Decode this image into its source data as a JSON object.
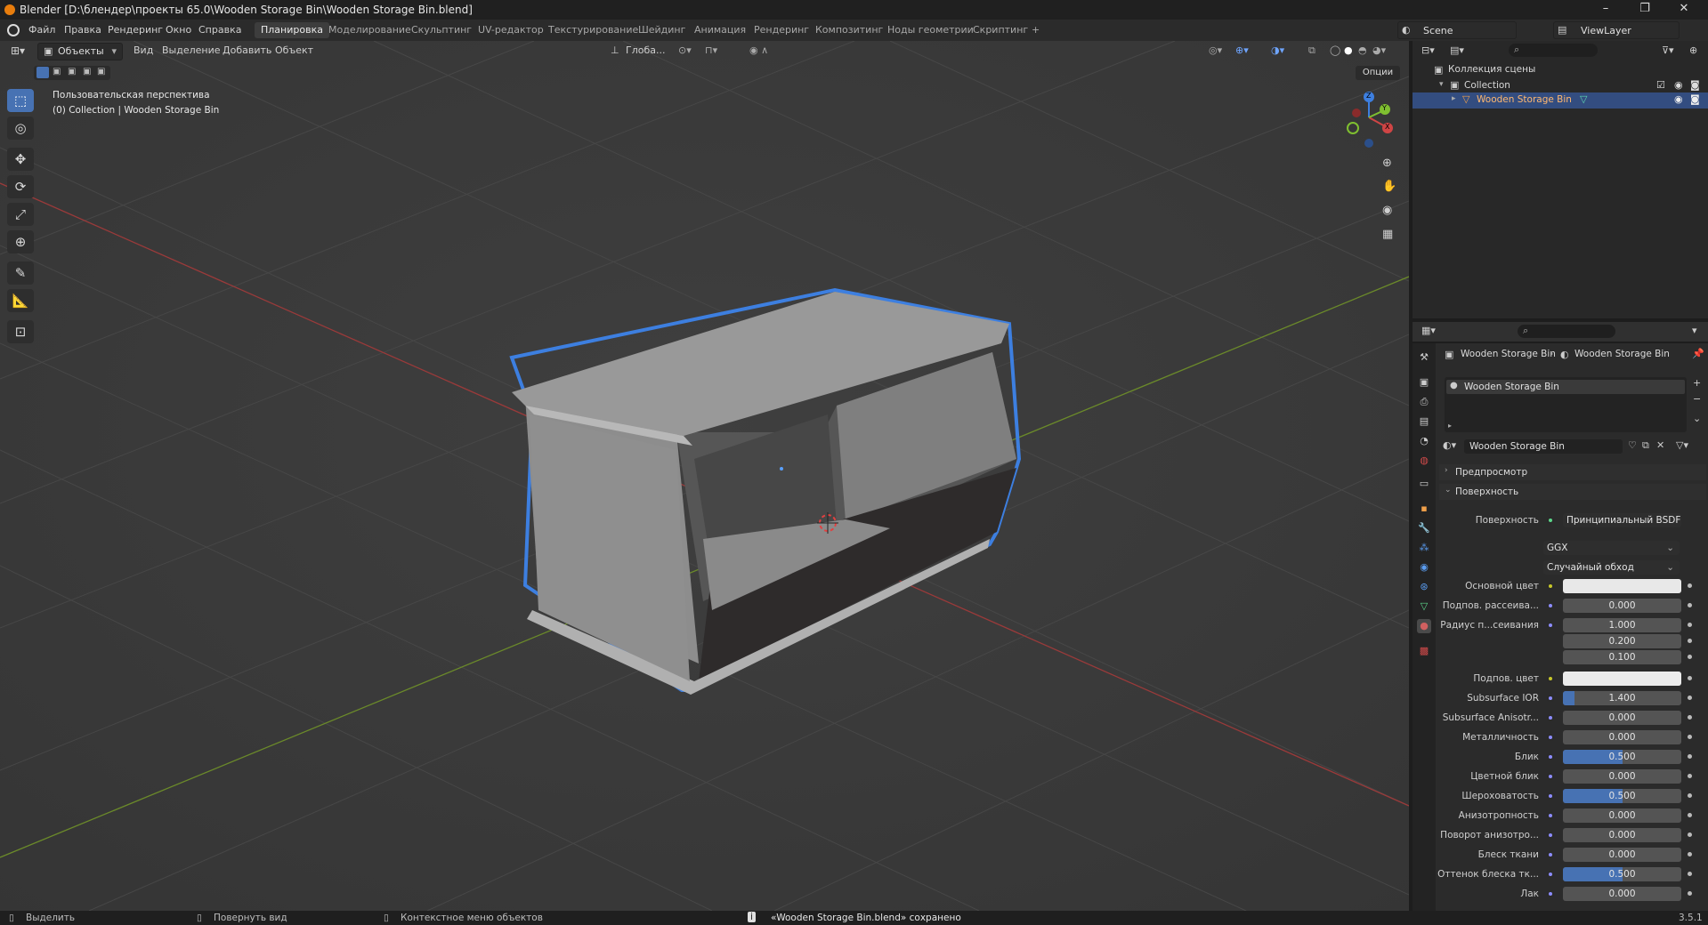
{
  "window": {
    "title": "Blender [D:\\блендер\\проекты 65.0\\Wooden Storage Bin\\Wooden Storage Bin.blend]",
    "controls": [
      "–",
      "❐",
      "✕"
    ]
  },
  "menu": [
    "Файл",
    "Правка",
    "Рендеринг",
    "Окно",
    "Справка"
  ],
  "workspaces": [
    "Планировка",
    "Моделирование",
    "Скульптинг",
    "UV-редактор",
    "Текстурирование",
    "Шейдинг",
    "Анимация",
    "Рендеринг",
    "Композитинг",
    "Ноды геометрии",
    "Скриптинг",
    "+"
  ],
  "active_workspace_index": 0,
  "scene": {
    "name": "Scene",
    "view_layer": "ViewLayer"
  },
  "viewport": {
    "mode": "Объекты",
    "menus": [
      "Вид",
      "Выделение",
      "Добавить",
      "Объект"
    ],
    "orientation": "Глоба...",
    "options_label": "Опции",
    "overlay_title": "Пользовательская перспектива",
    "overlay_sub": "(0) Collection | Wooden Storage Bin",
    "gizmo_labels": {
      "x": "X",
      "y": "Y",
      "z": "Z"
    }
  },
  "outliner": {
    "search_placeholder": "",
    "scene_collection": "Коллекция сцены",
    "collection": "Collection",
    "object": "Wooden Storage Bin"
  },
  "properties": {
    "breadcrumb_object": "Wooden Storage Bin",
    "breadcrumb_material": "Wooden Storage Bin",
    "material_slot": "Wooden Storage Bin",
    "material_name": "Wooden Storage Bin",
    "panel_preview": "Предпросмотр",
    "panel_surface": "Поверхность",
    "surface_label": "Поверхность",
    "surface_value": "Принципиальный BSDF",
    "distribution": "GGX",
    "subsurface_method": "Случайный обход",
    "rows": [
      {
        "label": "Основной цвет",
        "value": "",
        "type": "color",
        "color": "#e8e8e8",
        "dot": "y"
      },
      {
        "label": "Подпов. рассеива...",
        "value": "0.000",
        "type": "num",
        "fill": 0,
        "dot": "b"
      },
      {
        "label": "Радиус п...сеивания",
        "value": "1.000",
        "type": "num",
        "fill": 0,
        "dot": "b"
      },
      {
        "label": "",
        "value": "0.200",
        "type": "num",
        "fill": 0,
        "dot": ""
      },
      {
        "label": "",
        "value": "0.100",
        "type": "num",
        "fill": 0,
        "dot": ""
      },
      {
        "label": "Подпов. цвет",
        "value": "",
        "type": "color",
        "color": "#ececec",
        "dot": "y"
      },
      {
        "label": "Subsurface IOR",
        "value": "1.400",
        "type": "num",
        "fill": 0.1,
        "dot": "b"
      },
      {
        "label": "Subsurface Anisotr...",
        "value": "0.000",
        "type": "num",
        "fill": 0,
        "dot": "b"
      },
      {
        "label": "Металличность",
        "value": "0.000",
        "type": "num",
        "fill": 0,
        "dot": "b"
      },
      {
        "label": "Блик",
        "value": "0.500",
        "type": "num",
        "fill": 0.5,
        "dot": "b"
      },
      {
        "label": "Цветной блик",
        "value": "0.000",
        "type": "num",
        "fill": 0,
        "dot": "b"
      },
      {
        "label": "Шероховатость",
        "value": "0.500",
        "type": "num",
        "fill": 0.5,
        "dot": "b"
      },
      {
        "label": "Анизотропность",
        "value": "0.000",
        "type": "num",
        "fill": 0,
        "dot": "b"
      },
      {
        "label": "Поворот анизотро...",
        "value": "0.000",
        "type": "num",
        "fill": 0,
        "dot": "b"
      },
      {
        "label": "Блеск ткани",
        "value": "0.000",
        "type": "num",
        "fill": 0,
        "dot": "b"
      },
      {
        "label": "Оттенок блеска тк...",
        "value": "0.500",
        "type": "num",
        "fill": 0.5,
        "dot": "b"
      },
      {
        "label": "Лак",
        "value": "0.000",
        "type": "num",
        "fill": 0,
        "dot": "b"
      }
    ]
  },
  "statusbar": {
    "select": "Выделить",
    "rotate": "Повернуть вид",
    "context": "Контекстное меню объектов",
    "message": "«Wooden Storage Bin.blend» сохранено",
    "version": "3.5.1"
  },
  "colors": {
    "accent": "#4772b3",
    "selection_outline": "#3d7fe0",
    "x_axis": "#c24545",
    "y_axis": "#7fa436"
  }
}
